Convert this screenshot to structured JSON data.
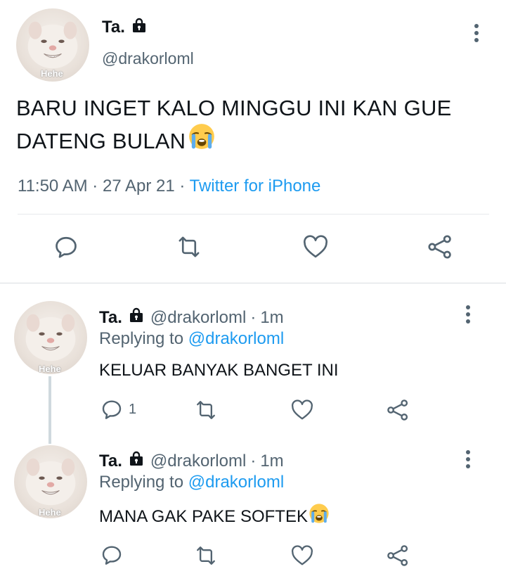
{
  "main_tweet": {
    "display_name": "Ta.",
    "handle": "@drakorloml",
    "avatar_caption": "Hehe",
    "text": "BARU INGET KALO MINGGU INI KAN GUE DATENG BULAN",
    "emoji": "crying-face-emoji",
    "time": "11:50 AM",
    "date": "27 Apr 21",
    "source": "Twitter for iPhone",
    "separator": "·"
  },
  "replies": [
    {
      "display_name": "Ta.",
      "handle": "@drakorloml",
      "time_ago": "1m",
      "separator": "·",
      "replying_prefix": "Replying to",
      "replying_to": "@drakorloml",
      "avatar_caption": "Hehe",
      "text": "KELUAR BANYAK BANGET INI",
      "reply_count": "1"
    },
    {
      "display_name": "Ta.",
      "handle": "@drakorloml",
      "time_ago": "1m",
      "separator": "·",
      "replying_prefix": "Replying to",
      "replying_to": "@drakorloml",
      "avatar_caption": "Hehe",
      "text": "MANA GAK PAKE SOFTEK",
      "reply_count": ""
    }
  ],
  "icons": {
    "reply": "reply-icon",
    "retweet": "retweet-icon",
    "like": "like-icon",
    "share": "share-icon",
    "more": "more-options-icon",
    "lock": "lock-icon"
  },
  "colors": {
    "text": "#0f1419",
    "secondary": "#536471",
    "link": "#1d9bf0",
    "divider": "#e6e9ec",
    "thread_line": "#cfd9de"
  }
}
